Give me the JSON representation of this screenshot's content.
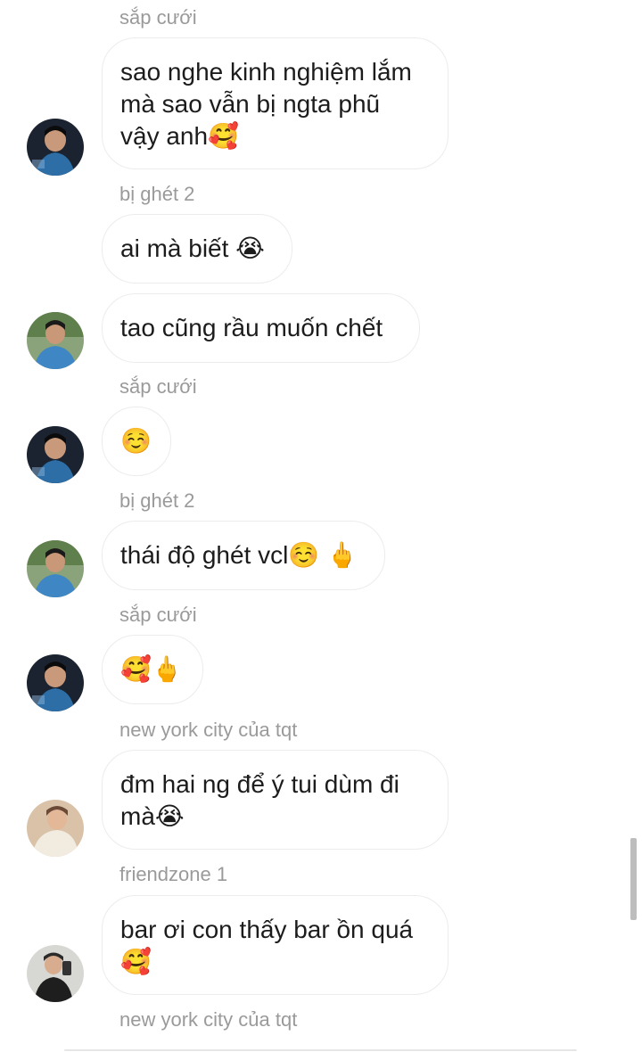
{
  "messages": [
    {
      "sender": "sắp cưới",
      "lines": [
        "sao nghe kinh nghiệm lắm",
        "mà sao vẫn bị ngta phũ",
        "vậy anh🥰"
      ]
    },
    {
      "sender": "bị ghét 2",
      "lines": [
        "ai mà biết 😭"
      ]
    },
    {
      "sender": "",
      "lines": [
        "tao cũng rầu muốn chết"
      ]
    },
    {
      "sender": "sắp cưới",
      "lines": [
        "☺️"
      ]
    },
    {
      "sender": "bị ghét 2",
      "lines": [
        "thái độ ghét vcl☺️ 🖕"
      ]
    },
    {
      "sender": "sắp cưới",
      "lines": [
        "🥰🖕"
      ]
    },
    {
      "sender": "new york city của tqt",
      "lines": [
        "đm hai ng để ý tui dùm đi",
        "mà😭"
      ]
    },
    {
      "sender": "friendzone 1",
      "lines": [
        "bar ơi con thấy bar ồn quá",
        "🥰"
      ]
    },
    {
      "sender": "new york city của tqt",
      "lines": []
    }
  ],
  "avatars": {
    "sap_cuoi": "dark-hair-man-avatar",
    "bi_ghet_2": "man-blue-shirt-avatar",
    "new_york_city": "person-light-jacket-avatar",
    "friendzone_1": "mirror-selfie-avatar"
  }
}
